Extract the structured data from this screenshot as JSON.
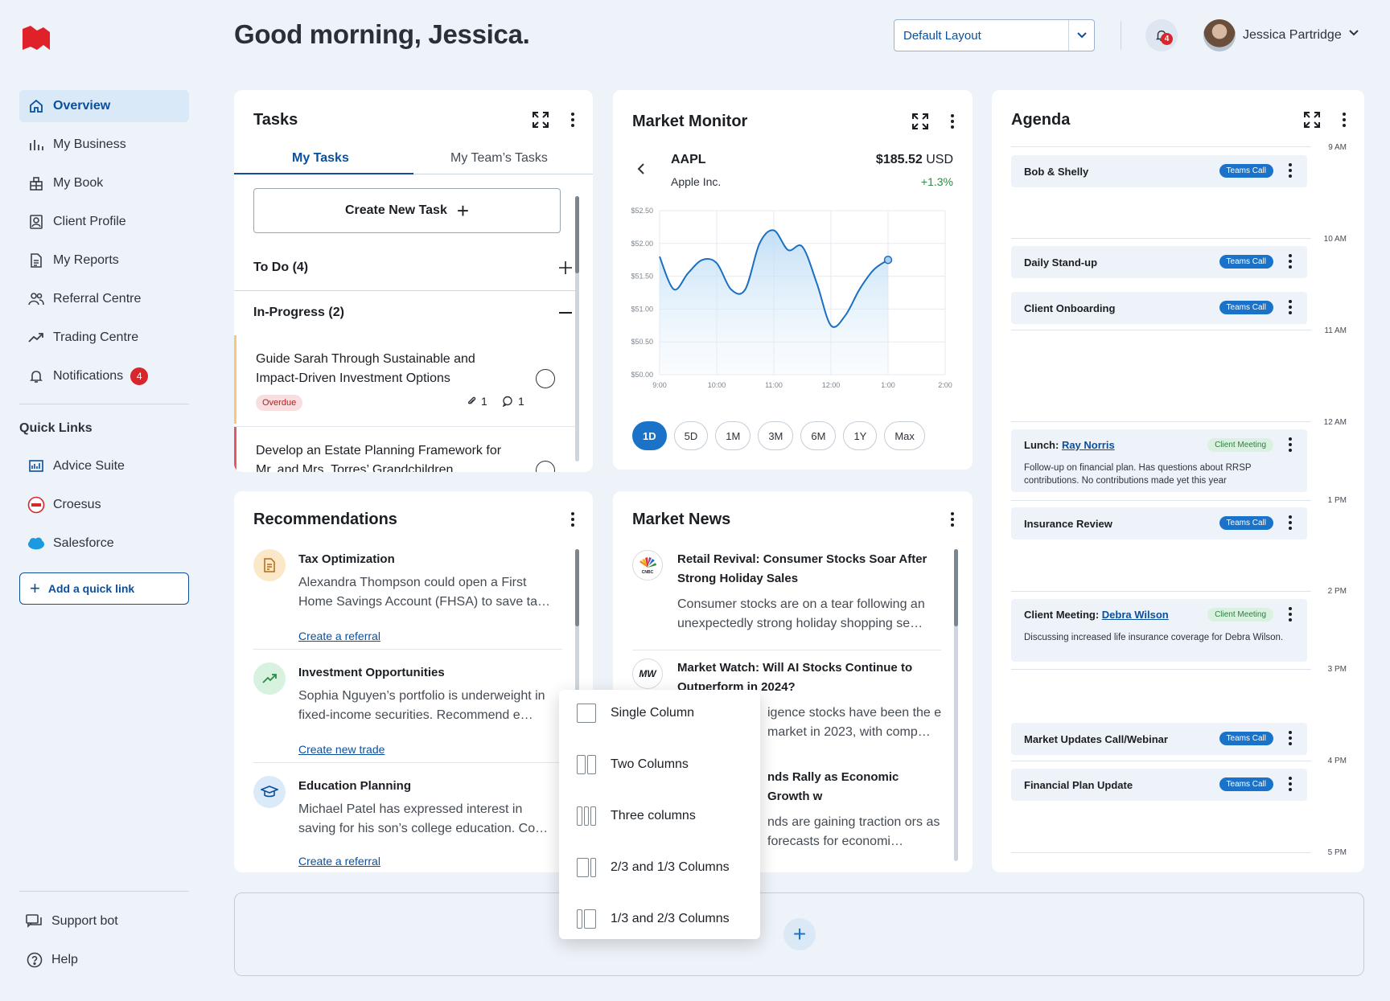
{
  "header": {
    "greeting": "Good morning, Jessica.",
    "layout_selected": "Default Layout",
    "notification_count": "4",
    "user_name": "Jessica Partridge"
  },
  "sidebar": {
    "items": [
      {
        "label": "Overview",
        "icon": "home-icon"
      },
      {
        "label": "My Business",
        "icon": "bar-chart-icon"
      },
      {
        "label": "My Book",
        "icon": "book-icon"
      },
      {
        "label": "Client Profile",
        "icon": "profile-icon"
      },
      {
        "label": "My Reports",
        "icon": "report-icon"
      },
      {
        "label": "Referral Centre",
        "icon": "users-icon"
      },
      {
        "label": "Trading Centre",
        "icon": "trend-icon"
      },
      {
        "label": "Notifications",
        "icon": "bell-icon",
        "badge": "4"
      }
    ],
    "quick_links_title": "Quick Links",
    "quick_links": [
      {
        "label": "Advice Suite"
      },
      {
        "label": "Croesus"
      },
      {
        "label": "Salesforce"
      }
    ],
    "add_quick_link": "Add a quick link",
    "support_bot": "Support bot",
    "help": "Help"
  },
  "tasks": {
    "title": "Tasks",
    "tabs": [
      "My Tasks",
      "My Team’s Tasks"
    ],
    "create_button": "Create New Task",
    "todo_label": "To Do (4)",
    "inprogress_label": "In-Progress (2)",
    "items": [
      {
        "text": "Guide Sarah Through Sustainable and Impact-Driven Investment Options",
        "status": "Overdue",
        "attachments": "1",
        "comments": "1",
        "accent": "#f5c97a"
      },
      {
        "text": "Develop an Estate Planning Framework for Mr. and Mrs. Torres’ Grandchildren",
        "accent": "#e05a5f"
      }
    ]
  },
  "market_monitor": {
    "title": "Market Monitor",
    "ticker": "AAPL",
    "company": "Apple Inc.",
    "price": "$185.52",
    "currency": "USD",
    "change": "+1.3%",
    "ranges": [
      "1D",
      "5D",
      "1M",
      "3M",
      "6M",
      "1Y",
      "Max"
    ],
    "active_range": "1D"
  },
  "chart_data": {
    "type": "area",
    "title": "",
    "xlabel": "",
    "ylabel": "",
    "x_ticks": [
      "9:00",
      "10:00",
      "11:00",
      "12:00",
      "1:00",
      "2:00"
    ],
    "y_ticks": [
      "$52.50",
      "$52.00",
      "$51.50",
      "$51.00",
      "$50.50",
      "$50.00"
    ],
    "ylim": [
      50.0,
      52.5
    ],
    "x": [
      9.0,
      9.25,
      9.5,
      9.75,
      10.0,
      10.25,
      10.5,
      10.75,
      11.0,
      11.25,
      11.5,
      11.75,
      12.0,
      12.25,
      12.5,
      12.75,
      13.0
    ],
    "values": [
      51.8,
      51.3,
      51.55,
      51.75,
      51.7,
      51.3,
      51.3,
      52.0,
      52.2,
      51.9,
      51.95,
      51.4,
      50.75,
      50.9,
      51.3,
      51.6,
      51.75
    ]
  },
  "recommendations": {
    "title": "Recommendations",
    "items": [
      {
        "title": "Tax Optimization",
        "body": "Alexandra Thompson could open a First Home Savings Account (FHSA) to save ta…",
        "link": "Create a referral",
        "icon": "tax-document-icon"
      },
      {
        "title": "Investment Opportunities",
        "body": "Sophia Nguyen’s portfolio is underweight in fixed-income securities. Recommend e…",
        "link": "Create new trade",
        "icon": "trend-up-icon"
      },
      {
        "title": "Education Planning",
        "body": "Michael Patel has expressed interest in saving for his son’s college education. Co…",
        "link": "Create a referral",
        "icon": "graduation-cap-icon"
      }
    ]
  },
  "news": {
    "title": "Market News",
    "items": [
      {
        "logo": "CNBC",
        "title": "Retail Revival: Consumer Stocks Soar After Strong Holiday Sales",
        "body": "Consumer stocks are on a tear following an unexpectedly strong holiday shopping se…"
      },
      {
        "logo": "MW",
        "title": "Market Watch: Will AI Stocks Continue to Outperform in 2024?",
        "body": "igence stocks have been the e market in 2023, with comp…"
      },
      {
        "logo": "",
        "title": "nds Rally as Economic Growth w",
        "body": "nds are gaining traction ors as forecasts for economi…"
      }
    ]
  },
  "agenda": {
    "title": "Agenda",
    "times": [
      "9 AM",
      "10 AM",
      "11 AM",
      "12 AM",
      "1 PM",
      "2 PM",
      "3 PM",
      "4 PM",
      "5 PM"
    ],
    "events": [
      {
        "title": "Bob & Shelly",
        "badge": "Teams Call",
        "type": "teams"
      },
      {
        "title": "Daily Stand-up",
        "badge": "Teams Call",
        "type": "teams"
      },
      {
        "title": "Client Onboarding",
        "badge": "Teams Call",
        "type": "teams"
      },
      {
        "title_prefix": "Lunch: ",
        "title_link": "Ray Norris",
        "badge": "Client Meeting",
        "type": "client",
        "desc": "Follow-up on financial plan. Has questions about RRSP contributions. No contributions made yet this year"
      },
      {
        "title": "Insurance Review",
        "badge": "Teams Call",
        "type": "teams"
      },
      {
        "title_prefix": "Client Meeting: ",
        "title_link": "Debra Wilson",
        "badge": "Client Meeting",
        "type": "client",
        "desc": "Discussing increased life insurance coverage for Debra Wilson."
      },
      {
        "title": "Market Updates Call/Webinar",
        "badge": "Teams Call",
        "type": "teams"
      },
      {
        "title": "Financial Plan Update",
        "badge": "Teams Call",
        "type": "teams"
      }
    ]
  },
  "layout_menu": {
    "options": [
      "Single Column",
      "Two Columns",
      "Three columns",
      "2/3 and 1/3 Columns",
      "1/3 and 2/3 Columns"
    ]
  },
  "colors": {
    "brand": "#e0212a",
    "accent": "#0b4f9c",
    "primary_button": "#1a73c9",
    "background": "#eef3f9"
  }
}
